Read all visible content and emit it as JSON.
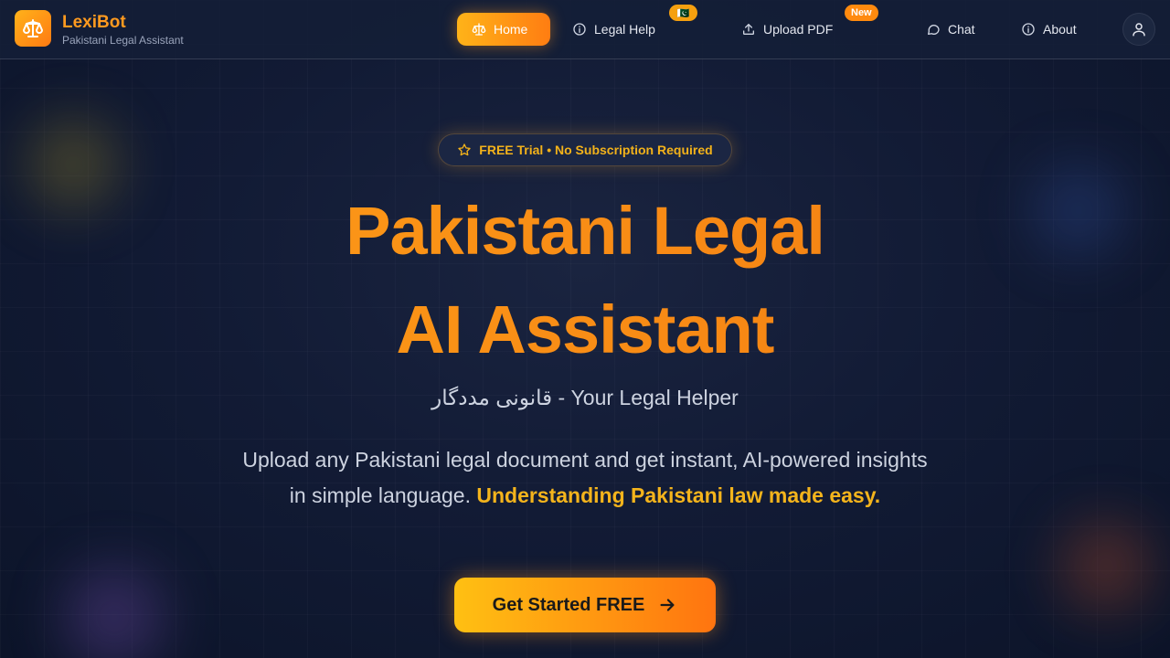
{
  "colors": {
    "accent_orange": "#ff8a12",
    "accent_yellow": "#f4b41c",
    "background": "#0f1830"
  },
  "brand": {
    "name": "LexiBot",
    "tagline": "Pakistani Legal Assistant",
    "logo_icon": "scales-icon"
  },
  "nav": {
    "items": [
      {
        "label": "Home",
        "icon": "scales-icon",
        "active": true
      },
      {
        "label": "Legal Help",
        "icon": "info-icon",
        "badge": "🇵🇰"
      },
      {
        "label": "Upload PDF",
        "icon": "upload-icon",
        "badge": "New"
      },
      {
        "label": "Chat",
        "icon": "chat-bubble-icon"
      },
      {
        "label": "About",
        "icon": "info-icon"
      }
    ],
    "profile_icon": "user-icon"
  },
  "hero": {
    "pill": "FREE Trial • No Subscription Required",
    "pill_icon": "star-icon",
    "headline_line1": "Pakistani Legal",
    "headline_line2": "AI Assistant",
    "subtitle": "قانونی مددگار - Your Legal Helper",
    "description": "Upload any Pakistani legal document and get instant, AI-powered insights in simple language.",
    "description_highlight": "Understanding Pakistani law made easy.",
    "cta_label": "Get Started FREE",
    "cta_icon": "arrow-right-icon"
  }
}
